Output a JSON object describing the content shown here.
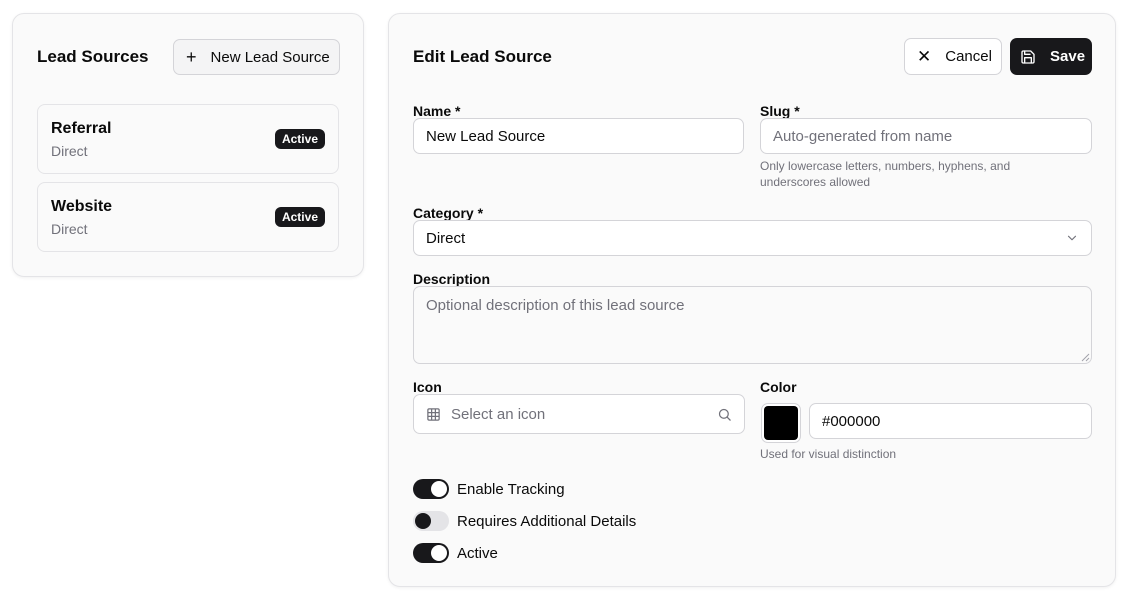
{
  "sidebar": {
    "title": "Lead Sources",
    "new_button_label": "New Lead Source",
    "items": [
      {
        "name": "Referral",
        "category": "Direct",
        "status": "Active"
      },
      {
        "name": "Website",
        "category": "Direct",
        "status": "Active"
      }
    ]
  },
  "editor": {
    "title": "Edit Lead Source",
    "cancel_label": "Cancel",
    "save_label": "Save",
    "name": {
      "label": "Name *",
      "value": "New Lead Source"
    },
    "slug": {
      "label": "Slug *",
      "placeholder": "Auto-generated from name",
      "hint_line1": "Only lowercase letters, numbers, hyphens, and",
      "hint_line2": "underscores allowed"
    },
    "category": {
      "label": "Category *",
      "value": "Direct"
    },
    "description": {
      "label": "Description",
      "placeholder": "Optional description of this lead source"
    },
    "icon": {
      "label": "Icon",
      "placeholder": "Select an icon"
    },
    "color": {
      "label": "Color",
      "value": "#000000",
      "hint": "Used for visual distinction",
      "swatch": "#000000"
    },
    "toggles": [
      {
        "label": "Enable Tracking",
        "on": true
      },
      {
        "label": "Requires Additional Details",
        "on": false
      },
      {
        "label": "Active",
        "on": true
      }
    ]
  }
}
